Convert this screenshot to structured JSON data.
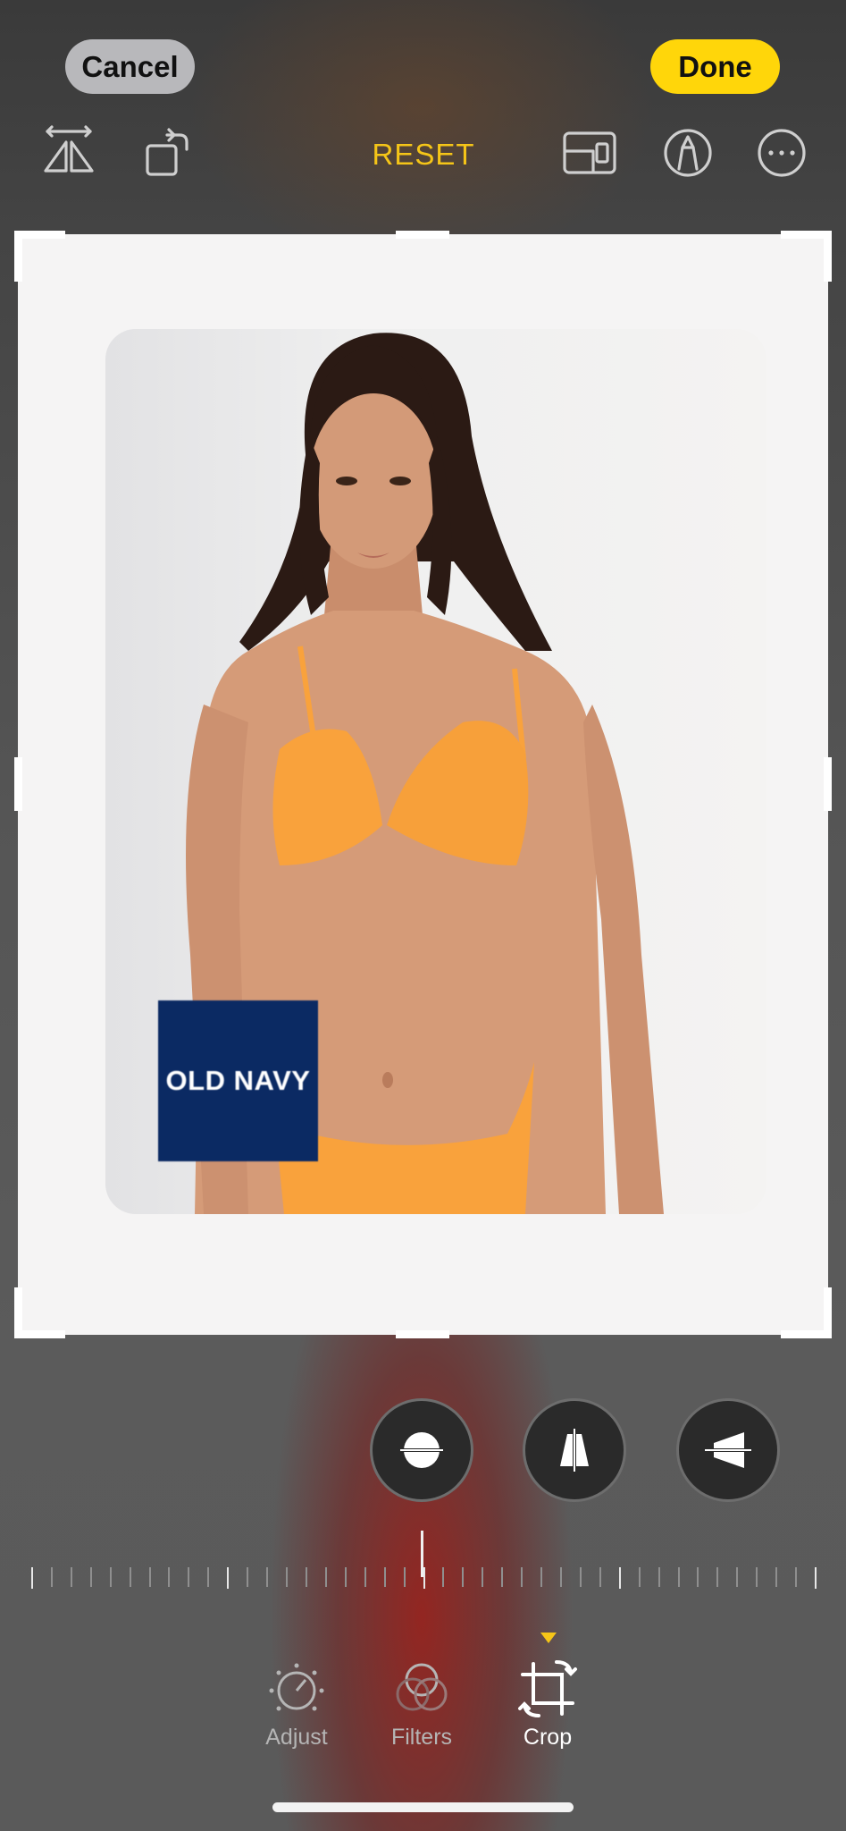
{
  "toolbar": {
    "cancel_label": "Cancel",
    "done_label": "Done",
    "reset_label": "RESET",
    "accent_color": "#ffd60a"
  },
  "tools": {
    "left": [
      "flip-horizontal-icon",
      "rotate-icon"
    ],
    "right": [
      "aspect-ratio-icon",
      "markup-pen-icon",
      "more-icon"
    ]
  },
  "image": {
    "logo_text": "OLD NAVY",
    "logo_color": "#0b2a63",
    "swimsuit_color": "#f9a23c"
  },
  "straighten": [
    "straighten-icon",
    "vertical-perspective-icon",
    "horizontal-perspective-icon"
  ],
  "ruler": {
    "value": 0
  },
  "tabs": [
    {
      "label": "Adjust",
      "icon": "adjust-dial-icon",
      "active": false
    },
    {
      "label": "Filters",
      "icon": "filters-icon",
      "active": false
    },
    {
      "label": "Crop",
      "icon": "crop-rotate-icon",
      "active": true
    }
  ]
}
